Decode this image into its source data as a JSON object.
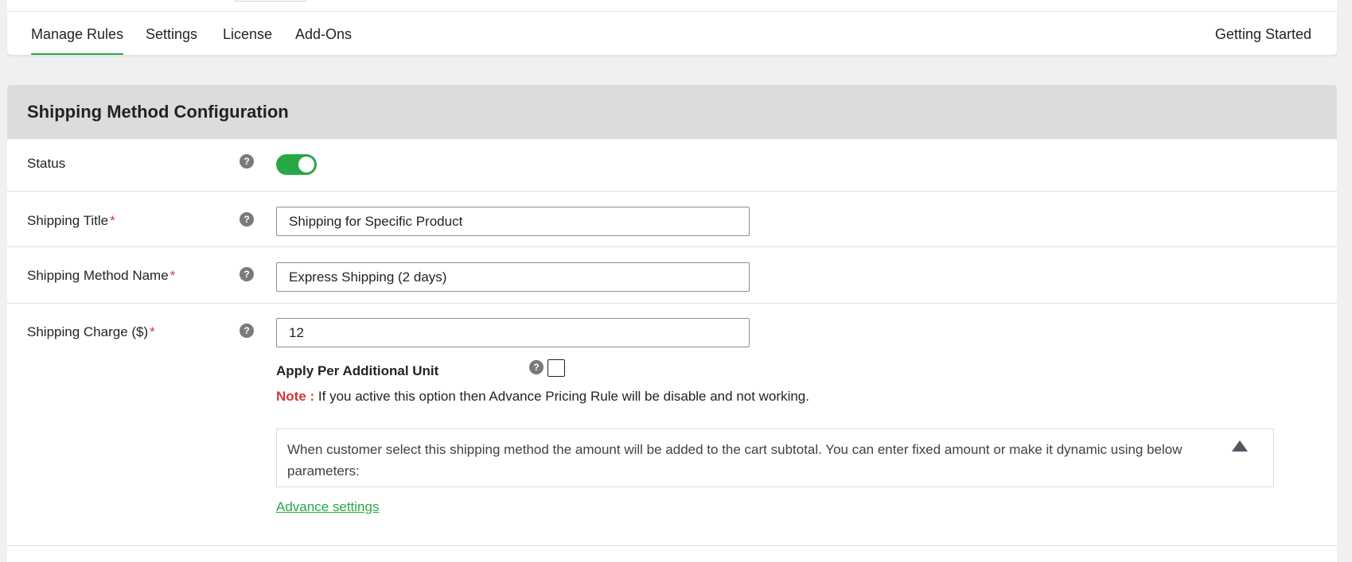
{
  "nav": {
    "tabs": [
      {
        "label": "Manage Rules",
        "active": true
      },
      {
        "label": "Settings",
        "active": false
      },
      {
        "label": "License",
        "active": false
      },
      {
        "label": "Add-Ons",
        "active": false
      }
    ],
    "right_link": "Getting Started"
  },
  "panel": {
    "title": "Shipping Method Configuration",
    "status": {
      "label": "Status",
      "enabled": true
    },
    "shipping_title": {
      "label": "Shipping Title",
      "required_mark": "*",
      "value": "Shipping for Specific Product"
    },
    "method_name": {
      "label": "Shipping Method Name",
      "required_mark": "*",
      "value": "Express Shipping (2 days)"
    },
    "charge": {
      "label": "Shipping Charge ($)",
      "required_mark": "*",
      "value": "12",
      "per_unit_label": "Apply Per Additional Unit",
      "per_unit_checked": false,
      "note_tag": "Note :",
      "note_text": " If you active this option then Advance Pricing Rule will be disable and not working.",
      "info_text": "When customer select this shipping method the amount will be added to the cart subtotal. You can enter fixed amount or make it dynamic using below parameters:",
      "advance_link": "Advance settings"
    },
    "help_glyph": "?"
  },
  "colors": {
    "accent": "#28a745",
    "required": "#d63638",
    "header_bg": "#dcdcdc"
  },
  "icons": {
    "help": "question-circle-icon",
    "collapse": "triangle-up-icon"
  }
}
